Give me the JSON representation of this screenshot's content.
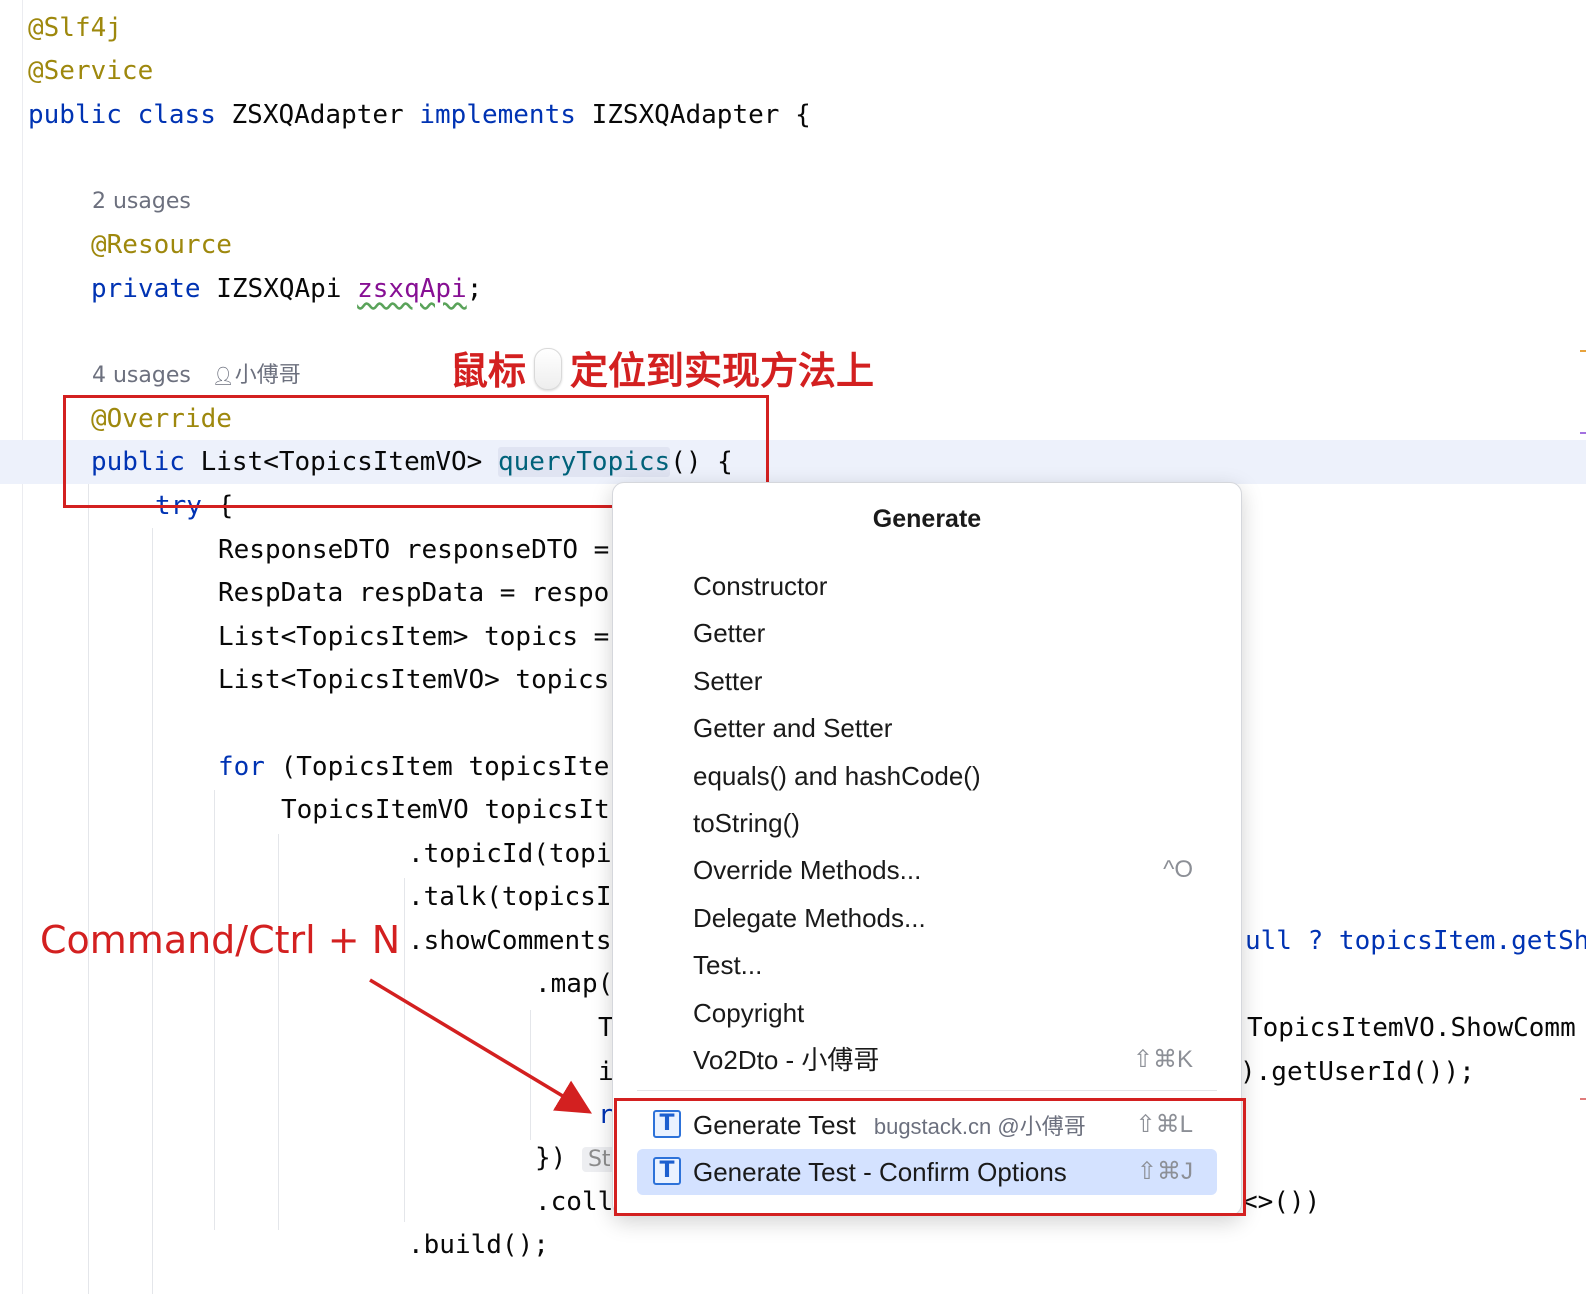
{
  "editor": {
    "lines": {
      "slf4j": "@Slf4j",
      "service": "@Service",
      "kw_public": "public",
      "kw_class": "class",
      "class_name": "ZSXQAdapter",
      "kw_implements": "implements",
      "iface_name": "IZSXQAdapter",
      "brace_open": "{",
      "usages_field": "2 usages",
      "resource": "@Resource",
      "kw_private": "private",
      "field_type": "IZSXQApi",
      "field_name": "zsxqApi",
      "semicolon": ";",
      "usages_method": "4 usages",
      "author": "小傅哥",
      "override": "@Override",
      "method_return": "List<TopicsItemVO>",
      "method_name": "queryTopics",
      "method_tail": "() {",
      "kw_try": "try",
      "line_response": "ResponseDTO responseDTO =",
      "line_respdata": "RespData respData = respo",
      "line_topics": "List<TopicsItem> topics =",
      "line_topicsvo": "List<TopicsItemVO> topics",
      "kw_for": "for",
      "line_for_tail": "(TopicsItem topicsIte",
      "line_builder": "TopicsItemVO topicsIt",
      "line_topicid": ".topicId(topi",
      "line_talk": ".talk(topicsI",
      "line_showcomments": ".showComments",
      "line_showcomments_right": "ull ? topicsItem.getSh",
      "line_map": ".map(",
      "line_t": "T",
      "line_t_right": "TopicsItemVO.ShowComm",
      "line_i": "i",
      "line_i_right": ").getUserId());",
      "line_r": "r",
      "line_close": "})",
      "inlay_str": "Str",
      "line_coll": ".coll",
      "line_coll_right": "<>())",
      "line_build": ".build();"
    }
  },
  "annotations": {
    "top_callout": "鼠标",
    "top_callout_tail": "定位到实现方法上",
    "shortcut_callout": "Command/Ctrl + N",
    "accent_color": "#d32020"
  },
  "popup": {
    "title": "Generate",
    "items": [
      {
        "label": "Constructor"
      },
      {
        "label": "Getter"
      },
      {
        "label": "Setter"
      },
      {
        "label": "Getter and Setter"
      },
      {
        "label": "equals() and hashCode()"
      },
      {
        "label": "toString()"
      },
      {
        "label": "Override Methods...",
        "shortcut": "^O"
      },
      {
        "label": "Delegate Methods..."
      },
      {
        "label": "Test..."
      },
      {
        "label": "Copyright"
      },
      {
        "label": "Vo2Dto - 小傅哥",
        "shortcut": "⇧⌘K"
      }
    ],
    "plugin_items": [
      {
        "label": "Generate Test",
        "sub": "bugstack.cn @小傅哥",
        "shortcut": "⇧⌘L",
        "icon": "test-plugin-icon"
      },
      {
        "label": "Generate Test - Confirm Options",
        "shortcut": "⇧⌘J",
        "icon": "test-plugin-icon",
        "selected": true
      }
    ],
    "selection_color": "#d4e2ff"
  }
}
